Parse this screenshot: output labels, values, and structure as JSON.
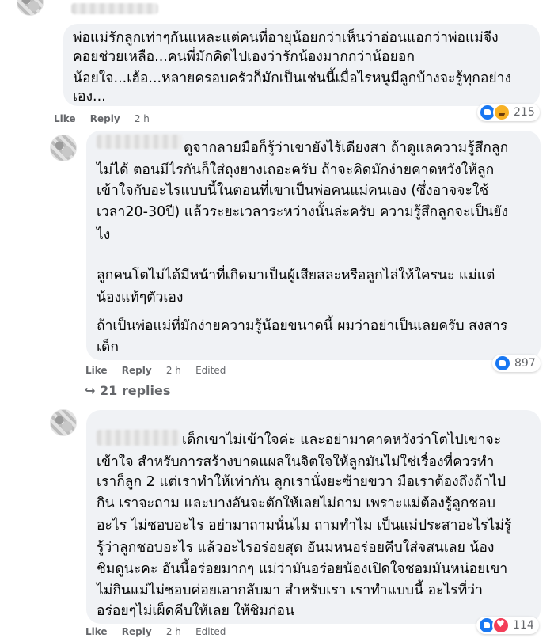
{
  "comments": [
    {
      "lines": [
        "พ่อแม่รักลูกเท่าๆกันแหละแต่คนที่อายุน้อยกว่าเห็นว่าอ่อนแอกว่าพ่อแม่จึง",
        "คอยช่วยเหลือ...คนพี่มักคิดไปเองว่ารักน้องมากกว่าน้อยอก",
        "น้อยใจ...เฮ้อ...หลายครอบครัวก็มักเป็นเช่นนี้เมื่อไรหนูมีลูกบ้างจะรู้ทุกอย่าง",
        "เอง..."
      ],
      "like": "Like",
      "reply": "Reply",
      "time": "2 h",
      "reaction_count": "215"
    },
    {
      "lines": [
        "ดูจากลายมือก็รู้ว่าเขายังไร้เดียงสา ถ้าดูแลความรู้สึกลูก",
        "ไม่ได้ ตอนมีไรกันก็ใส่ถุงยางเถอะครับ ถ้าจะคิดมักง่ายคาดหวังให้ลูก",
        "เข้าใจกับอะไรแบบนี้ในตอนที่เขาเป็นพ่อคนแม่คนเอง (ซึ่งอาจจะใช้",
        "เวลา20-30ปี) แล้วระยะเวลาระหว่างนั้นล่ะครับ ความรู้สึกลูกจะเป็นยัง",
        "ไง",
        "ลูกคนโตไม่ได้มีหน้าที่เกิดมาเป็นผู้เสียสละหรือลูกไล่ให้ใครนะ แม่แต่",
        "น้องแท้ๆตัวเอง",
        "ถ้าเป็นพ่อแม่ที่มักง่ายความรู้น้อยขนาดนี้ ผมว่าอย่าเป็นเลยครับ สงสาร",
        "เด็ก"
      ],
      "like": "Like",
      "reply": "Reply",
      "time": "2 h",
      "edited": "Edited",
      "reaction_count": "897",
      "replies_label": "21 replies"
    },
    {
      "lines": [
        "เด็กเขาไม่เข้าใจค่ะ และอย่ามาคาดหวังว่าโตไปเขาจะ",
        "เข้าใจ สำหรับการสร้างบาดแผลในจิตใจให้ลูกมันไม่ใช่เรื่องที่ควรทำ",
        "เราก็ลูก 2 แต่เราทำให้เท่ากัน ลูกเรานั่งยะซ้ายขวา มือเราต้องถึงถ้าไป",
        "กิน เราจะถาม และบางอันจะตักให้เลยไม่ถาม เพราะแม่ต้องรู้ลูกชอบ",
        "อะไร ไม่ชอบอะไร อย่ามาถามนั่นไม ถามทำไม เป็นแม่ประสาอะไรไม่รู้",
        "รู้ว่าลูกชอบอะไร แล้วอะไรอร่อยสุด อันมหนอร่อยคีบใส่จสนเลย น้อง",
        "ชิมดูนะคะ อันนี้อร่อยมากๆ แม่ว่ามันอร่อยน้องเปิดใจชอมมันหน่อยเขา",
        "ไม่กินแม่ไม่ชอบค่อยเอากลับมา สำหรับเรา เราทำแบบนี้ อะไรที่ว่า",
        "อร่อยๆไม่เผ็ดคีบให้เลย ให้ชิมก่อน"
      ],
      "like": "Like",
      "reply": "Reply",
      "time": "2 h",
      "edited": "Edited",
      "reaction_count": "114"
    }
  ],
  "icons": {
    "like": "like-reaction-icon",
    "haha": "haha-reaction-icon",
    "love": "love-reaction-icon",
    "replies_arrow": "reply-arrow-icon"
  },
  "colors": {
    "bubble": "#f0f2f5",
    "meta_text": "#65676b",
    "like_blue": "#1877f2",
    "haha_yellow": "#f7b125",
    "love_red": "#f33e58"
  }
}
